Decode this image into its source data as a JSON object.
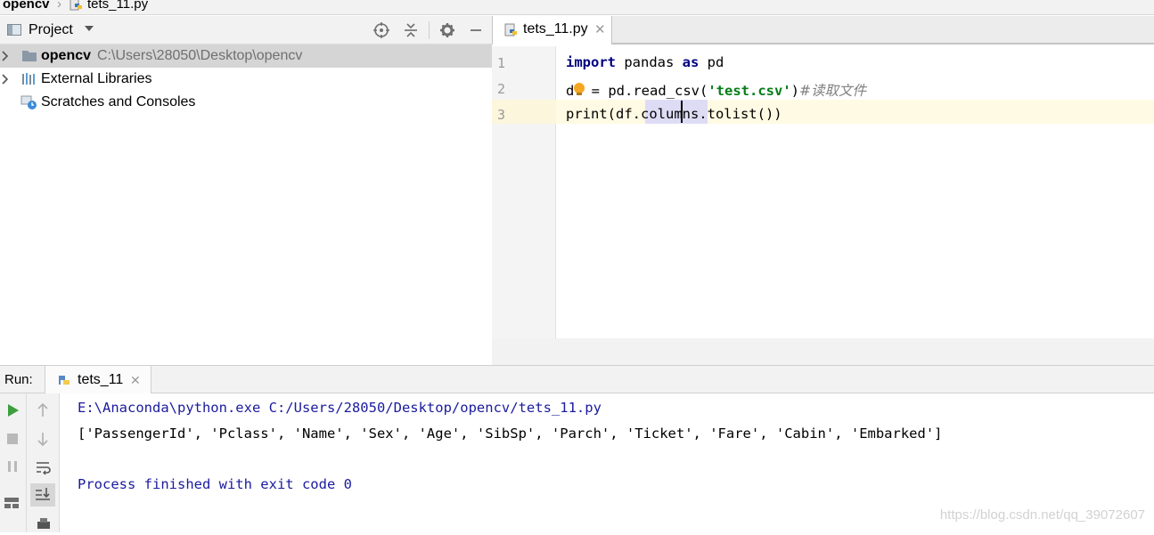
{
  "breadcrumb": {
    "project": "opencv",
    "file": "tets_11.py"
  },
  "project_panel": {
    "title": "Project",
    "tree": [
      {
        "label": "opencv",
        "path": "C:\\Users\\28050\\Desktop\\opencv",
        "selected": true,
        "icon": "folder-icon"
      },
      {
        "label": "External Libraries",
        "icon": "library-icon"
      },
      {
        "label": "Scratches and Consoles",
        "icon": "scratches-icon"
      }
    ]
  },
  "editor": {
    "tab_label": "tets_11.py",
    "line_numbers": [
      "1",
      "2",
      "3"
    ],
    "lines": {
      "l1_kw1": "import",
      "l1_mid": " pandas ",
      "l1_kw2": "as",
      "l1_end": " pd",
      "l2_a": "d",
      "l2_b": " = pd.read_csv(",
      "l2_str": "'test.csv'",
      "l2_c": ")",
      "l2_cmt": "#读取文件",
      "l3": "print(df.columns.tolist())"
    }
  },
  "run_panel": {
    "label": "Run:",
    "tab_label": "tets_11",
    "console": [
      "E:\\Anaconda\\python.exe C:/Users/28050/Desktop/opencv/tets_11.py",
      "['PassengerId', 'Pclass', 'Name', 'Sex', 'Age', 'SibSp', 'Parch', 'Ticket', 'Fare', 'Cabin', 'Embarked']",
      "",
      "Process finished with exit code 0"
    ],
    "watermark": "https://blog.csdn.net/qq_39072607"
  },
  "colors": {
    "keyword": "#000080",
    "string": "#067d17",
    "comment": "#808080",
    "console_blue": "#1b1b9e",
    "run_green": "#3d9e3d"
  }
}
